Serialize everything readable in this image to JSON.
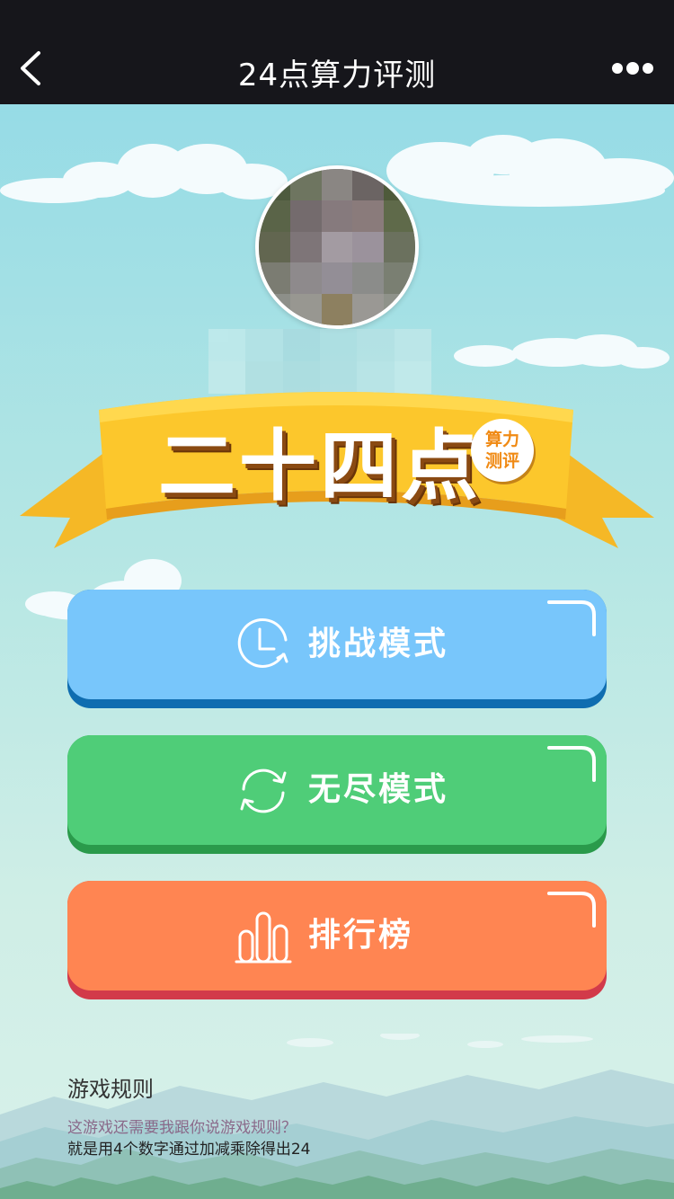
{
  "nav": {
    "title": "24点算力评测",
    "back_icon": "chevron-left-icon",
    "more_icon": "more-dots-icon"
  },
  "hero": {
    "banner_title": "二十四点",
    "badge_line1": "算力",
    "badge_line2": "测评"
  },
  "modes": [
    {
      "label": "挑战模式",
      "icon": "clock-refresh-icon",
      "color": "#78c6fb"
    },
    {
      "label": "无尽模式",
      "icon": "refresh-icon",
      "color": "#4fcd78"
    },
    {
      "label": "排行榜",
      "icon": "bar-chart-icon",
      "color": "#ff8552"
    }
  ],
  "rules": {
    "title": "游戏规则",
    "line1": "这游戏还需要我跟你说游戏规则？",
    "line2": "就是用4个数字通过加减乘除得出24"
  }
}
